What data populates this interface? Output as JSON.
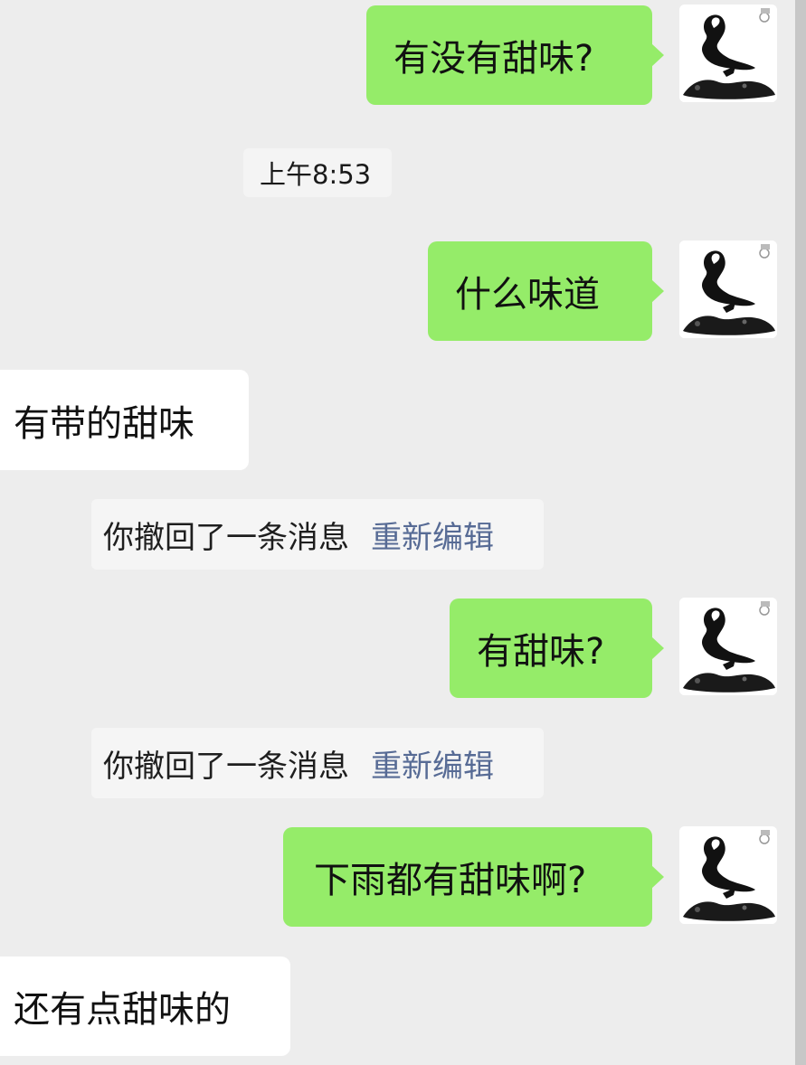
{
  "chat": {
    "messages": [
      {
        "text": "有没有甜味?"
      },
      {
        "text": "什么味道"
      },
      {
        "text": "有带的甜味"
      },
      {
        "text": "有甜味?"
      },
      {
        "text": "下雨都有甜味啊?"
      },
      {
        "text": "还有点甜味的"
      }
    ],
    "timestamp": "上午8:53",
    "recall_notices": [
      {
        "text": "你撤回了一条消息",
        "edit_label": "重新编辑"
      },
      {
        "text": "你撤回了一条消息",
        "edit_label": "重新编辑"
      }
    ]
  },
  "colors": {
    "background": "#ededed",
    "outgoing_bubble": "#95ec69",
    "incoming_bubble": "#ffffff",
    "edit_link": "#576b95"
  },
  "icons": {
    "avatar": "ink-painting-avatar-icon"
  }
}
